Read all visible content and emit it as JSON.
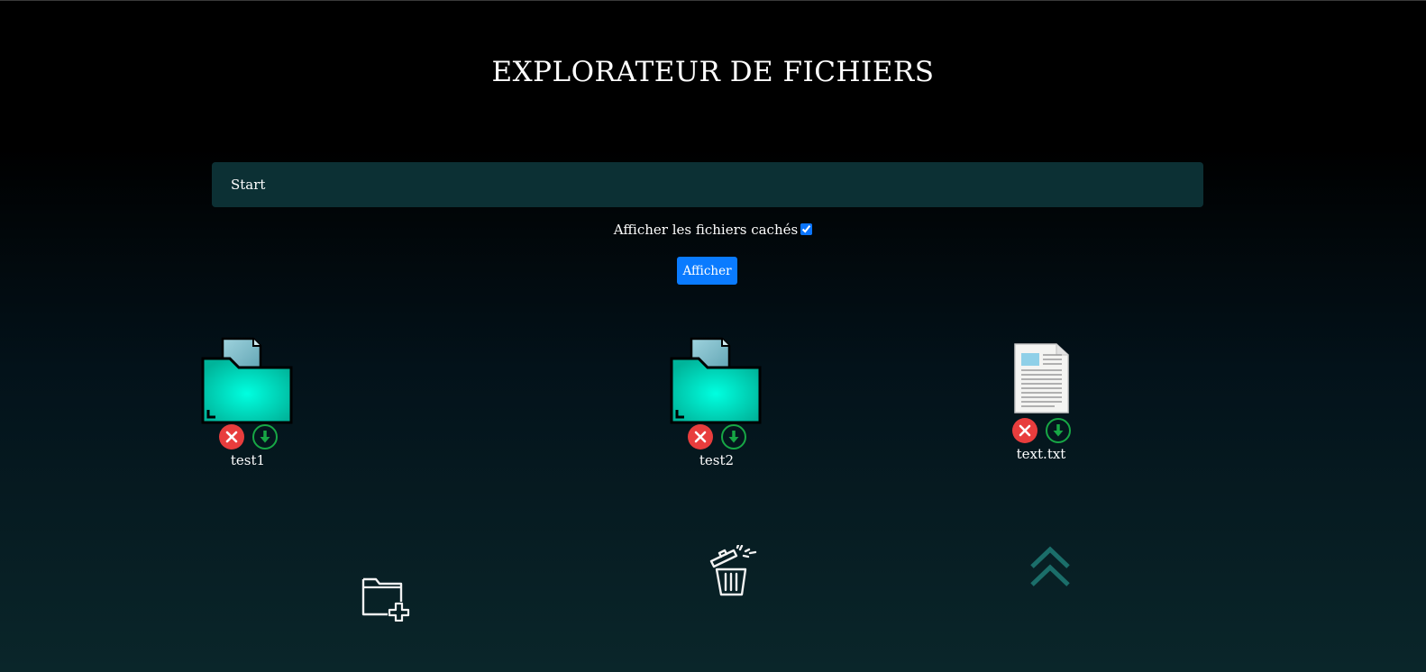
{
  "page": {
    "title": "EXPLORATEUR DE FICHIERS"
  },
  "path": {
    "label": "Start"
  },
  "filters": {
    "show_hidden_label": "Afficher les fichiers cachés",
    "show_hidden_checked": true
  },
  "show_button": {
    "label": "Afficher"
  },
  "items": [
    {
      "name": "test1",
      "type": "folder",
      "icon": "folder-icon"
    },
    {
      "name": "test2",
      "type": "folder",
      "icon": "folder-icon"
    },
    {
      "name": "text.txt",
      "type": "file",
      "icon": "text-file-icon"
    }
  ],
  "item_actions": {
    "delete_icon": "delete-icon",
    "download_icon": "download-icon"
  },
  "toolbar": {
    "new_folder_icon": "new-folder-icon",
    "trash_icon": "trash-icon",
    "parent_icon": "parent-directory-icon"
  },
  "colors": {
    "delete": "#e83d3d",
    "download": "#17a745",
    "primary_button": "#0a7bff",
    "folder": "#00e5c8",
    "path_bar": "#0c3034"
  }
}
